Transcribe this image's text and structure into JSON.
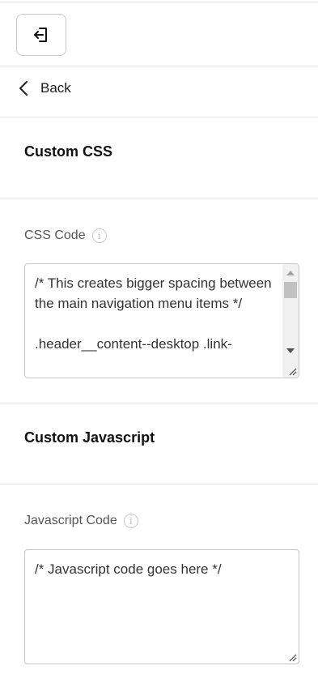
{
  "header": {
    "exit_icon": "exit-icon"
  },
  "nav": {
    "back_label": "Back",
    "back_icon": "chevron-left-icon"
  },
  "custom_css": {
    "title": "Custom CSS",
    "field_label": "CSS Code",
    "info_icon": "info-icon",
    "value": "/* This creates bigger spacing between the main navigation menu items */\n\n.header__content--desktop .link-"
  },
  "custom_js": {
    "title": "Custom Javascript",
    "field_label": "Javascript Code",
    "info_icon": "info-icon",
    "value": "/* Javascript code goes here */"
  },
  "colors": {
    "border": "#c6c6c6",
    "divider": "#e6e6e6",
    "label": "#555555",
    "text": "#111111"
  }
}
